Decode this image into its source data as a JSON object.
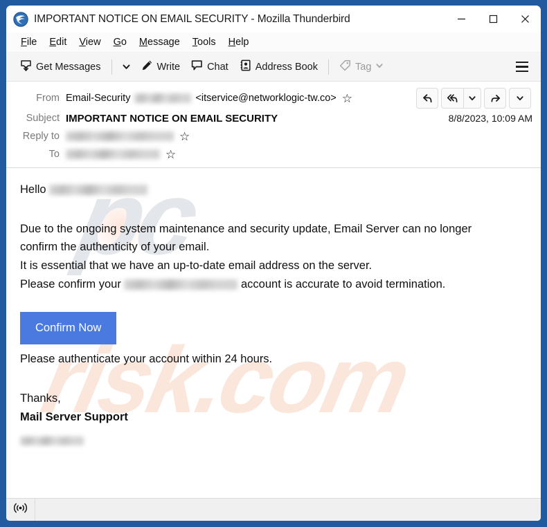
{
  "window": {
    "title": "IMPORTANT NOTICE ON EMAIL SECURITY - Mozilla Thunderbird",
    "app_name": "Mozilla Thunderbird",
    "border_color": "#215a9e",
    "controls": {
      "minimize": "–",
      "maximize": "□",
      "close": "✕"
    }
  },
  "menubar": {
    "items": [
      {
        "label": "File",
        "accel": "F"
      },
      {
        "label": "Edit",
        "accel": "E"
      },
      {
        "label": "View",
        "accel": "V"
      },
      {
        "label": "Go",
        "accel": "G"
      },
      {
        "label": "Message",
        "accel": "M"
      },
      {
        "label": "Tools",
        "accel": "T"
      },
      {
        "label": "Help",
        "accel": "H"
      }
    ]
  },
  "toolbar": {
    "get_messages_label": "Get Messages",
    "write_label": "Write",
    "chat_label": "Chat",
    "address_book_label": "Address Book",
    "tag_label": "Tag",
    "tag_disabled": true
  },
  "message_header": {
    "from_label": "From",
    "from_display_name": "Email-Security",
    "from_address": "<itservice@networklogic-tw.co>",
    "from_redacted": true,
    "subject_label": "Subject",
    "subject": "IMPORTANT NOTICE ON EMAIL SECURITY",
    "date": "8/8/2023, 10:09 AM",
    "reply_to_label": "Reply to",
    "reply_to_redacted": true,
    "to_label": "To",
    "to_redacted": true,
    "star_glyph": "☆",
    "actions": {
      "reply": "reply-arrow",
      "reply_all": "reply-all-arrow",
      "reply_all_more": "chevron-down",
      "forward": "forward-arrow",
      "more": "chevron-down"
    }
  },
  "body": {
    "greeting": "Hello",
    "greeting_recipient_redacted": true,
    "paragraph_1_line_1": "Due to the ongoing system maintenance and security update, Email Server can no longer",
    "paragraph_1_line_2": "confirm the authenticity of your email.",
    "paragraph_2": "It is essential that we have an up-to-date email address on the  server.",
    "paragraph_3_prefix": "Please confirm your",
    "paragraph_3_suffix": "account is accurate to avoid termination.",
    "confirm_button_label": "Confirm Now",
    "confirm_button_color": "#4a7ae0",
    "paragraph_4": "Please authenticate your account within 24 hours.",
    "closing": "Thanks,",
    "signature": "Mail Server Support",
    "signature_redacted": true,
    "watermark_primary": "pc",
    "watermark_secondary": "risk.com"
  },
  "statusbar": {
    "icon": "broadcast-icon"
  }
}
